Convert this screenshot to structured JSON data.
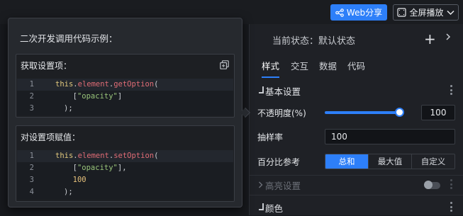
{
  "topbar": {
    "web_share_label": "Web分享",
    "fullscreen_label": "全屏播放"
  },
  "panel": {
    "status_text": "当前状态：默认状态",
    "tabs": [
      {
        "label": "样式",
        "active": true
      },
      {
        "label": "交互",
        "active": false
      },
      {
        "label": "数据",
        "active": false
      },
      {
        "label": "代码",
        "active": false
      }
    ],
    "basic_section_title": "基本设置",
    "opacity_label": "不透明度(%)",
    "opacity_value": "100",
    "opacity_level": 1.0,
    "sample_label": "抽样率",
    "sample_value": "100",
    "percent_label": "百分比参考",
    "percent_options": [
      "总和",
      "最大值",
      "自定义"
    ],
    "percent_selected": "总和",
    "highlight_section_title": "高亮设置",
    "color_section_title": "颜色"
  },
  "popover": {
    "title": "二次开发调用代码示例：",
    "get_card": {
      "title": "获取设置项：",
      "lines": [
        {
          "num": "1",
          "segments": [
            [
              "kw",
              "this"
            ],
            [
              "pl",
              "."
            ],
            [
              "fn",
              "element"
            ],
            [
              "pl",
              "."
            ],
            [
              "fn",
              "getOption"
            ],
            [
              "pl",
              "("
            ]
          ]
        },
        {
          "num": "2",
          "segments": [
            [
              "pl",
              "  ["
            ],
            [
              "st",
              "\"opacity\""
            ],
            [
              "pl",
              "]"
            ]
          ]
        },
        {
          "num": "3",
          "segments": [
            [
              "pl",
              ");"
            ]
          ]
        }
      ]
    },
    "set_card": {
      "title": "对设置项赋值：",
      "lines": [
        {
          "num": "1",
          "segments": [
            [
              "kw",
              "this"
            ],
            [
              "pl",
              "."
            ],
            [
              "fn",
              "element"
            ],
            [
              "pl",
              "."
            ],
            [
              "fn",
              "setOption"
            ],
            [
              "pl",
              "("
            ]
          ]
        },
        {
          "num": "2",
          "segments": [
            [
              "pl",
              "  ["
            ],
            [
              "st",
              "\"opacity\""
            ],
            [
              "pl",
              "],"
            ]
          ]
        },
        {
          "num": "3",
          "segments": [
            [
              "nm",
              "  100"
            ]
          ]
        },
        {
          "num": "4",
          "segments": [
            [
              "pl",
              ");"
            ]
          ]
        }
      ]
    }
  },
  "colors": {
    "accent": "#2d7ff9",
    "panel_bg": "#1f2126",
    "keyword": "#e0c77c",
    "function": "#e06c75",
    "string": "#98c379"
  }
}
